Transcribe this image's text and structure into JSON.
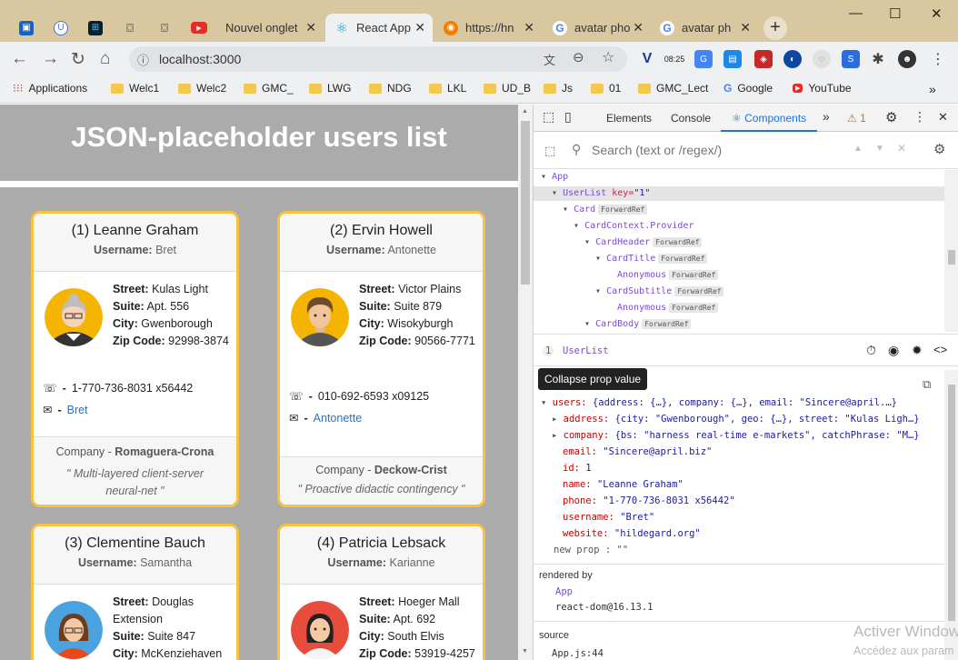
{
  "browser": {
    "tabs": [
      {
        "label": "Nouvel onglet"
      },
      {
        "label": "React App"
      },
      {
        "label": "https://hn"
      },
      {
        "label": "avatar pho"
      },
      {
        "label": "avatar ph"
      }
    ],
    "url": "localhost:3000",
    "ext_time": "08:25",
    "bookmarks": [
      "Applications",
      "Welc1",
      "Welc2",
      "GMC_",
      "LWG",
      "NDG",
      "LKL",
      "UD_B",
      "Js",
      "01",
      "GMC_Lect",
      "Google",
      "YouTube"
    ]
  },
  "page": {
    "title": "JSON-placeholder users list",
    "username_label": "Username:",
    "street_label": "Street:",
    "suite_label": "Suite:",
    "city_label": "City:",
    "zip_label": "Zip Code:",
    "company_label": "Company -",
    "cards": [
      {
        "name": "(1) Leanne Graham",
        "username": "Bret",
        "street": "Kulas Light",
        "suite": "Apt. 556",
        "city": "Gwenborough",
        "zip": "92998-3874",
        "phone": "1-770-736-8031 x56442",
        "website": "Bret",
        "company": "Romaguera-Crona",
        "catch1": "\" Multi-layered client-server",
        "catch2": "neural-net \""
      },
      {
        "name": "(2) Ervin Howell",
        "username": "Antonette",
        "street": "Victor Plains",
        "suite": "Suite 879",
        "city": "Wisokyburgh",
        "zip": "90566-7771",
        "phone": "010-692-6593 x09125",
        "website": "Antonette",
        "company": "Deckow-Crist",
        "catch1": "\" Proactive didactic contingency \""
      },
      {
        "name": "(3) Clementine Bauch",
        "username": "Samantha",
        "street": "Douglas",
        "street2": "Extension",
        "suite": "Suite 847",
        "city": "McKenziehaven"
      },
      {
        "name": "(4) Patricia Lebsack",
        "username": "Karianne",
        "street": "Hoeger Mall",
        "suite": "Apt. 692",
        "city": "South Elvis",
        "zip": "53919-4257"
      }
    ]
  },
  "devtools": {
    "tabs": [
      "Elements",
      "Console",
      "Components"
    ],
    "active_tab": "Components",
    "warnings": "1",
    "search_placeholder": "Search (text or /regex/)",
    "tree": {
      "app": "App",
      "userlist": "UserList",
      "key_attr": "key=",
      "key_val": "\"1\"",
      "card": "Card",
      "provider": "CardContext.Provider",
      "header": "CardHeader",
      "title": "CardTitle",
      "anon1": "Anonymous",
      "subtitle": "CardSubtitle",
      "anon2": "Anonymous",
      "body": "CardBody",
      "forwardref": "ForwardRef"
    },
    "selected": {
      "index": "1",
      "name": "UserList"
    },
    "tooltip": "Collapse prop value",
    "props": {
      "users_key": "users:",
      "users_val": "{address: {…}, company: {…}, email: \"Sincere@april.…}",
      "address_key": "address:",
      "address_val": "{city: \"Gwenborough\", geo: {…}, street: \"Kulas Ligh…}",
      "company_key": "company:",
      "company_val": "{bs: \"harness real-time e-markets\", catchPhrase: \"M…}",
      "email_key": "email:",
      "email_val": "\"Sincere@april.biz\"",
      "id_key": "id:",
      "id_val": "1",
      "name_key": "name:",
      "name_val": "\"Leanne Graham\"",
      "phone_key": "phone:",
      "phone_val": "\"1-770-736-8031 x56442\"",
      "username_key": "username:",
      "username_val": "\"Bret\"",
      "website_key": "website:",
      "website_val": "\"hildegard.org\"",
      "new_prop": "new prop",
      "new_prop_val": ":  \"\""
    },
    "rendered_by_label": "rendered by",
    "rendered_by": [
      "App",
      "react-dom@16.13.1"
    ],
    "source_label": "source",
    "source": "App.js:44"
  },
  "watermark": {
    "line1": "Activer Windows",
    "line2": "Accédez aux param"
  },
  "colors": {
    "card_border": "#f7c242",
    "page_bg": "#ababab",
    "link": "#2a73c9"
  }
}
